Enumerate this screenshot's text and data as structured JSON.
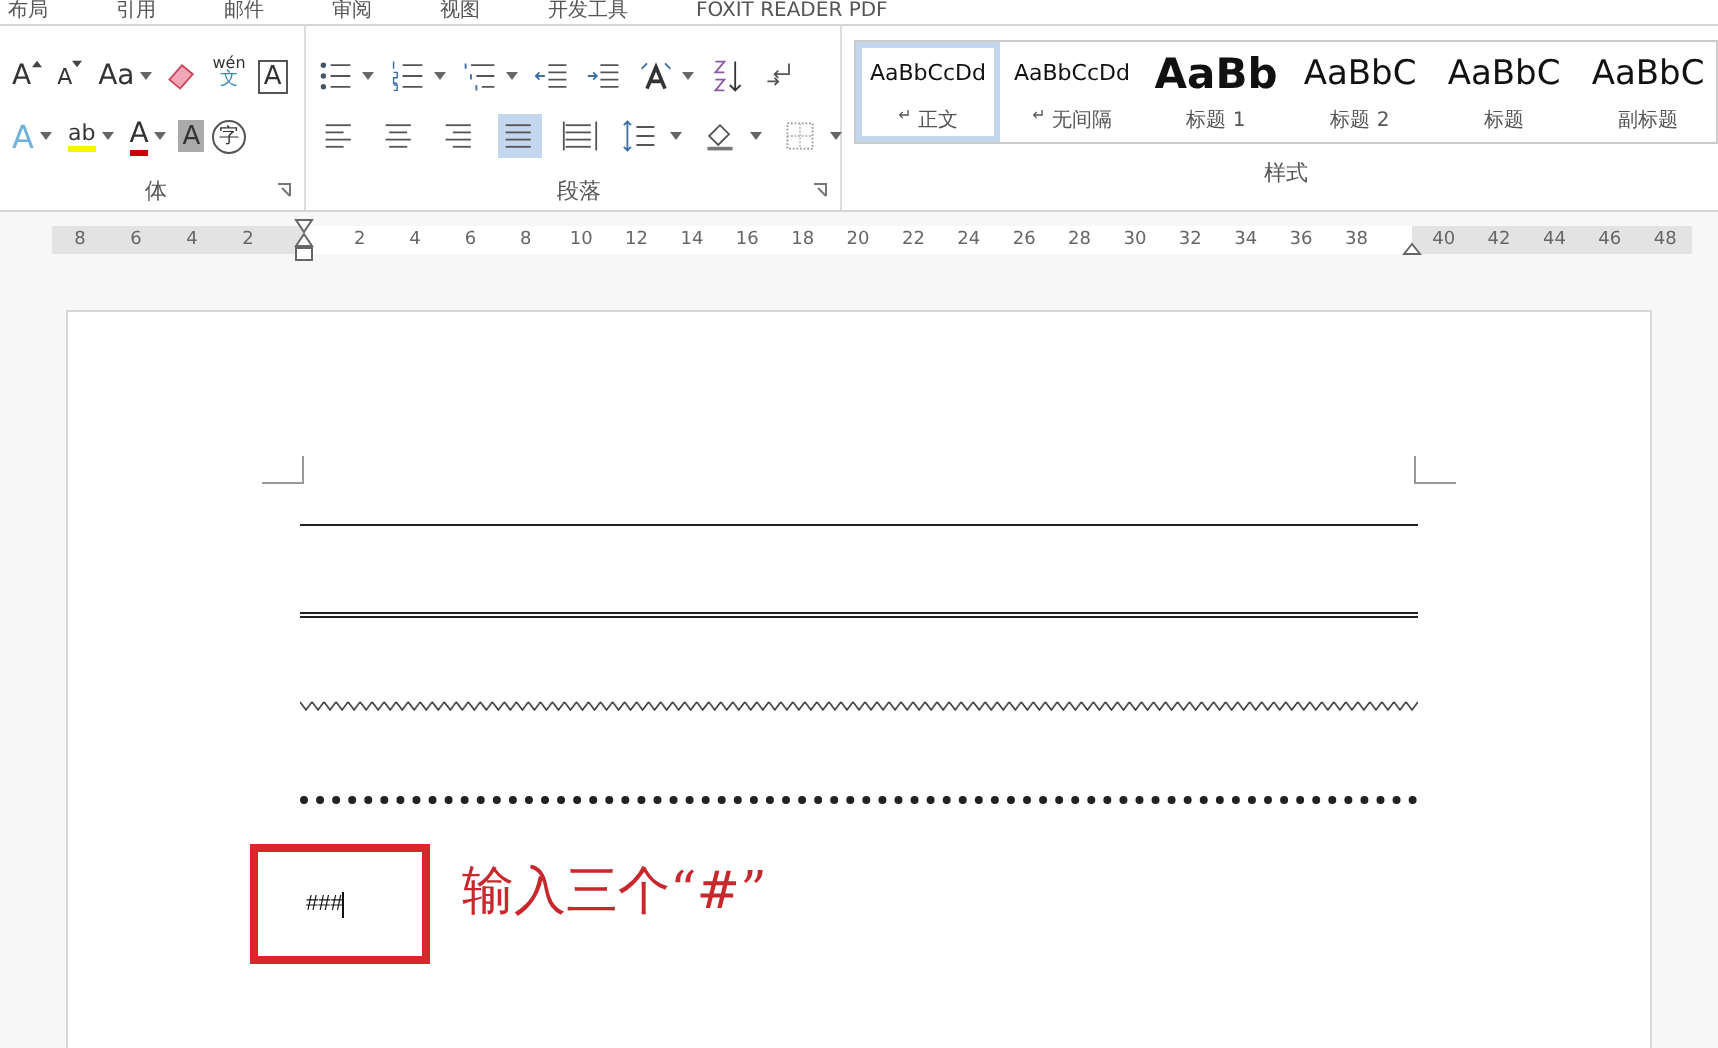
{
  "tabs": [
    {
      "label": "布局"
    },
    {
      "label": "引用"
    },
    {
      "label": "邮件"
    },
    {
      "label": "审阅"
    },
    {
      "label": "视图"
    },
    {
      "label": "开发工具"
    },
    {
      "label": "FOXIT READER PDF"
    }
  ],
  "font_group": {
    "label": "体",
    "row1": [
      {
        "kind": "grow",
        "label": "A"
      },
      {
        "kind": "shrink",
        "label": "A"
      },
      {
        "kind": "case",
        "label": "Aa"
      },
      {
        "kind": "eraser"
      },
      {
        "kind": "phonetic",
        "label": "wén",
        "sub": "文"
      },
      {
        "kind": "boxed",
        "label": "A"
      }
    ],
    "row2": [
      {
        "kind": "effect",
        "label": "A"
      },
      {
        "kind": "highlight",
        "label": "ab"
      },
      {
        "kind": "fontcolor",
        "label": "A"
      },
      {
        "kind": "shade",
        "label": "A"
      },
      {
        "kind": "enclose",
        "label": "字"
      }
    ]
  },
  "paragraph_group": {
    "label": "段落",
    "row1": [
      {
        "kind": "bullets"
      },
      {
        "kind": "numbering"
      },
      {
        "kind": "multilevel"
      },
      {
        "kind": "outdent"
      },
      {
        "kind": "indent"
      },
      {
        "kind": "direction"
      },
      {
        "kind": "sort"
      },
      {
        "kind": "marks"
      }
    ],
    "row2": [
      {
        "kind": "align-left",
        "selected": false
      },
      {
        "kind": "align-center",
        "selected": false
      },
      {
        "kind": "align-right",
        "selected": false
      },
      {
        "kind": "justify",
        "selected": true
      },
      {
        "kind": "distributed",
        "selected": false
      },
      {
        "kind": "spacing",
        "selected": false
      },
      {
        "kind": "shading",
        "selected": false
      },
      {
        "kind": "borders",
        "selected": false
      }
    ]
  },
  "styles_group": {
    "label": "样式",
    "styles": [
      {
        "preview": "AaBbCcDd",
        "name": "正文",
        "mark": "↵",
        "kind": "small",
        "selected": true
      },
      {
        "preview": "AaBbCcDd",
        "name": "无间隔",
        "mark": "↵",
        "kind": "small",
        "selected": false
      },
      {
        "preview": "AaBb",
        "name": "标题 1",
        "kind": "heading1",
        "selected": false
      },
      {
        "preview": "AaBbC",
        "name": "标题 2",
        "kind": "heading2",
        "selected": false
      },
      {
        "preview": "AaBbC",
        "name": "标题",
        "kind": "title",
        "selected": false
      },
      {
        "preview": "AaBbC",
        "name": "副标题",
        "kind": "subtitle",
        "selected": false
      }
    ]
  },
  "ruler": {
    "left_ticks": [
      "8",
      "6",
      "4",
      "2"
    ],
    "body_ticks": [
      "2",
      "4",
      "6",
      "8",
      "10",
      "12",
      "14",
      "16",
      "18",
      "20",
      "22",
      "24",
      "26",
      "28",
      "30",
      "32",
      "34",
      "36",
      "38"
    ],
    "right_ticks": [
      "40",
      "42",
      "44",
      "46",
      "48"
    ]
  },
  "document": {
    "lines": [
      {
        "kind": "solid"
      },
      {
        "kind": "double"
      },
      {
        "kind": "wavy"
      },
      {
        "kind": "dotted"
      }
    ],
    "typed_text": "###",
    "annotation": "输入三个“#”"
  }
}
